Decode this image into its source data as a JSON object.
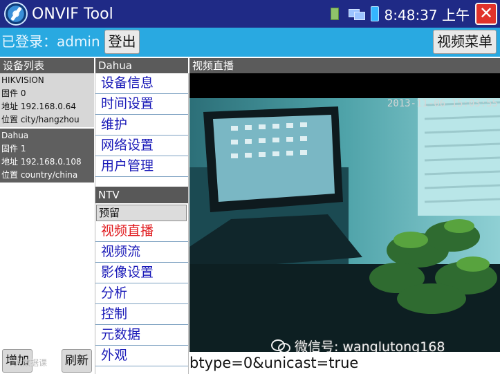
{
  "window": {
    "title": "ONVIF Tool",
    "clock": "8:48:37 上午",
    "icons": [
      "app-icon",
      "sd-card-icon",
      "network-icon",
      "battery-icon",
      "close-icon"
    ],
    "close_label": "✕"
  },
  "login": {
    "status_text": "已登录：admin",
    "logout_label": "登出",
    "video_menu_label": "视频菜单"
  },
  "devices": {
    "header": "设备列表",
    "items": [
      {
        "name": "HIKVISION",
        "firmware": "固件 0",
        "address": "地址 192.168.0.64",
        "location": "位置 city/hangzhou"
      },
      {
        "name": "Dahua",
        "firmware": "固件 1",
        "address": "地址 192.168.0.108",
        "location": "位置 country/china"
      }
    ],
    "add_label": "增加",
    "refresh_label": "刷新",
    "watermark": "大数据课"
  },
  "menu": {
    "header": "Dahua",
    "device_items": [
      "设备信息",
      "时间设置",
      "维护",
      "网络设置",
      "用户管理"
    ],
    "group_header": "NTV",
    "profile": "预留",
    "media_items": [
      "视频直播",
      "视频流",
      "影像设置",
      "分析",
      "控制",
      "元数据",
      "外观"
    ],
    "active_item": "视频直播"
  },
  "live": {
    "header": "视频直播",
    "osd_timestamp": "2013-11-06 15:03:55",
    "url_text": "btype=0&unicast=true",
    "watermark": "微信号: wanglutong168"
  },
  "colors": {
    "titlebar": "#1f2a86",
    "loginbar": "#29a9e1",
    "active_menu": "#e0181c",
    "menu_text": "#1a1ab8"
  }
}
